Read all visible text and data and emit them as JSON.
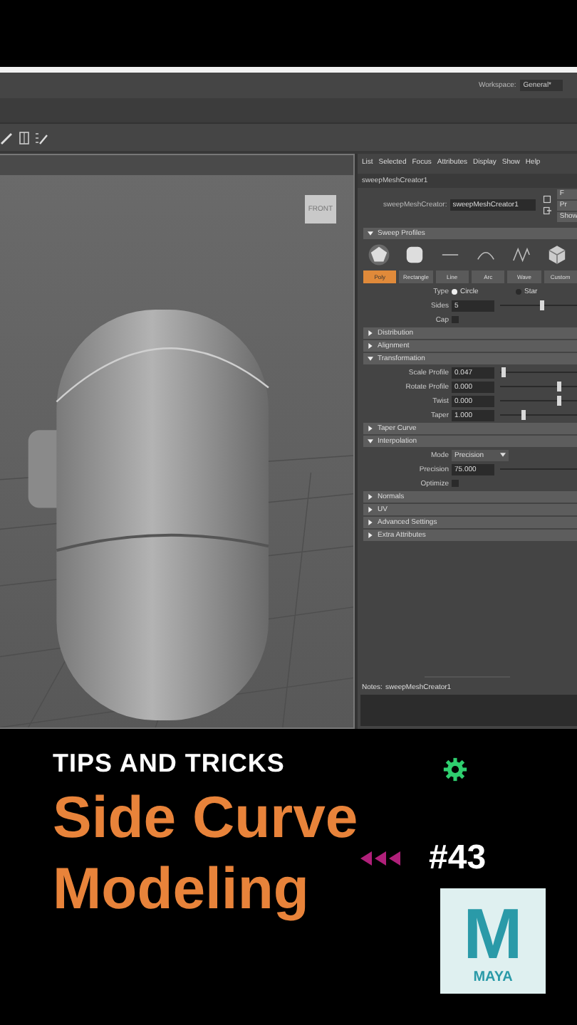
{
  "header": {
    "workspace_label": "Workspace:",
    "workspace_value": "General*"
  },
  "viewport": {
    "viewcube_label": "FRONT"
  },
  "attribute_editor": {
    "menu": [
      "List",
      "Selected",
      "Focus",
      "Attributes",
      "Display",
      "Show",
      "Help"
    ],
    "tab": "sweepMeshCreator1",
    "node_label": "sweepMeshCreator:",
    "node_value": "sweepMeshCreator1",
    "side_buttons": [
      "F",
      "Pr",
      "Show"
    ],
    "rows": [
      {
        "kind": "header",
        "title": "Sweep Profiles",
        "expanded": true
      },
      {
        "kind": "shape_icons"
      },
      {
        "kind": "shape_buttons",
        "buttons": [
          {
            "label": "Poly",
            "selected": true
          },
          {
            "label": "Rectangle",
            "selected": false
          },
          {
            "label": "Line",
            "selected": false
          },
          {
            "label": "Arc",
            "selected": false
          },
          {
            "label": "Wave",
            "selected": false
          },
          {
            "label": "Custom",
            "selected": false
          }
        ]
      },
      {
        "kind": "radio",
        "label": "Type",
        "options": [
          {
            "label": "Circle",
            "selected": true
          },
          {
            "label": "Star",
            "selected": false
          }
        ]
      },
      {
        "kind": "slider",
        "label": "Sides",
        "value": "5",
        "level": 0.53
      },
      {
        "kind": "checkbox",
        "label": "Cap",
        "checked": false
      },
      {
        "kind": "header",
        "title": "Distribution",
        "expanded": false
      },
      {
        "kind": "header",
        "title": "Alignment",
        "expanded": false
      },
      {
        "kind": "header",
        "title": "Transformation",
        "expanded": true
      },
      {
        "kind": "slider",
        "label": "Scale Profile",
        "value": "0.047",
        "level": 0.03
      },
      {
        "kind": "slider",
        "label": "Rotate Profile",
        "value": "0.000",
        "level": 0.76
      },
      {
        "kind": "slider",
        "label": "Twist",
        "value": "0.000",
        "level": 0.76
      },
      {
        "kind": "slider",
        "label": "Taper",
        "value": "1.000",
        "level": 0.29
      },
      {
        "kind": "header",
        "title": "Taper Curve",
        "expanded": false
      },
      {
        "kind": "header",
        "title": "Interpolation",
        "expanded": true
      },
      {
        "kind": "dropdown",
        "label": "Mode",
        "value": "Precision"
      },
      {
        "kind": "slider",
        "label": "Precision",
        "value": "75.000"
      },
      {
        "kind": "checkbox",
        "label": "Optimize",
        "checked": false
      },
      {
        "kind": "header",
        "title": "Normals",
        "expanded": false
      },
      {
        "kind": "header",
        "title": "UV",
        "expanded": false
      },
      {
        "kind": "header",
        "title": "Advanced Settings",
        "expanded": false
      },
      {
        "kind": "header",
        "title": "Extra Attributes",
        "expanded": false
      }
    ],
    "notes_label": "Notes:",
    "notes_value": "sweepMeshCreator1"
  },
  "overlay": {
    "kicker": "TIPS AND TRICKS",
    "title_lines": [
      "Side Curve",
      "Modeling"
    ],
    "episode": "#43",
    "logo_letter": "M",
    "logo_text": "MAYA"
  }
}
